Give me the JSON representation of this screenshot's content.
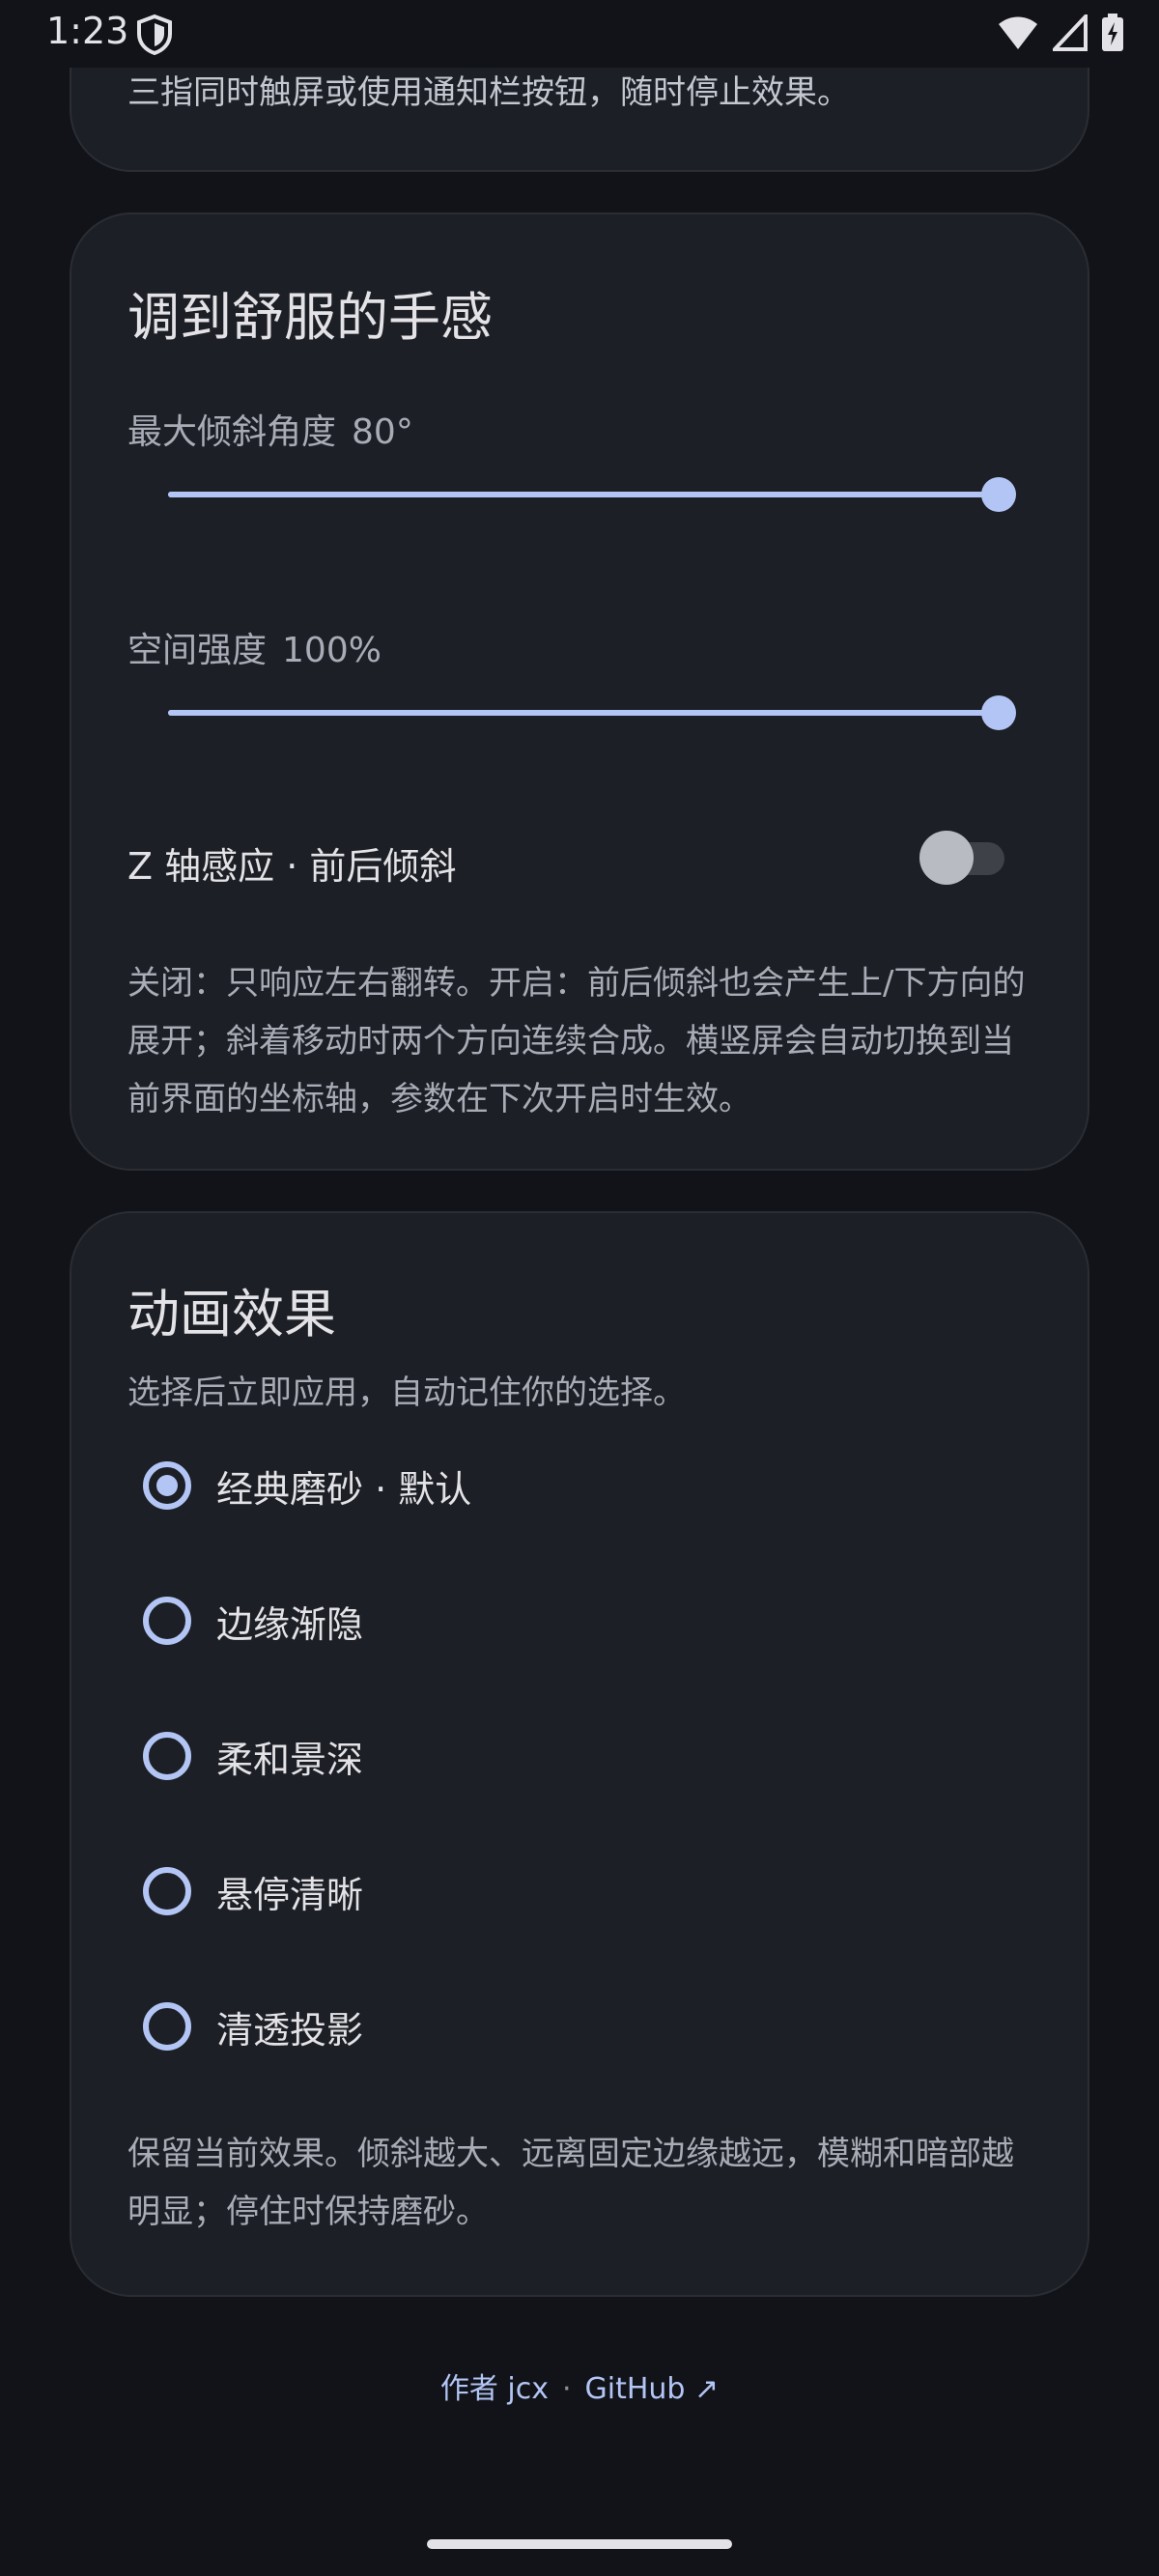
{
  "status_bar": {
    "time": "1:23"
  },
  "top_card": {
    "note": "三指同时触屏或使用通知栏按钮，随时停止效果。"
  },
  "feel_card": {
    "title": "调到舒服的手感",
    "max_tilt": {
      "label": "最大倾斜角度",
      "value_text": "80°",
      "level": 1.0
    },
    "space_strength": {
      "label": "空间强度",
      "value_text": "100%",
      "level": 1.0
    },
    "z_axis": {
      "label": "Z 轴感应 · 前后倾斜",
      "enabled": false
    },
    "description": "关闭：只响应左右翻转。开启：前后倾斜也会产生上/下方向的展开；斜着移动时两个方向连续合成。横竖屏会自动切换到当前界面的坐标轴，参数在下次开启时生效。"
  },
  "effect_card": {
    "title": "动画效果",
    "subtitle": "选择后立即应用，自动记住你的选择。",
    "options": [
      {
        "label": "经典磨砂 · 默认",
        "selected": true
      },
      {
        "label": "边缘渐隐",
        "selected": false
      },
      {
        "label": "柔和景深",
        "selected": false
      },
      {
        "label": "悬停清晰",
        "selected": false
      },
      {
        "label": "清透投影",
        "selected": false
      }
    ],
    "description": "保留当前效果。倾斜越大、远离固定边缘越远，模糊和暗部越明显；停住时保持磨砂。"
  },
  "footer": {
    "author": "作者 jcx",
    "separator": "·",
    "github": "GitHub ↗"
  },
  "colors": {
    "background": "#111318",
    "card": "#1c1f25",
    "accent": "#b3c5f5"
  }
}
